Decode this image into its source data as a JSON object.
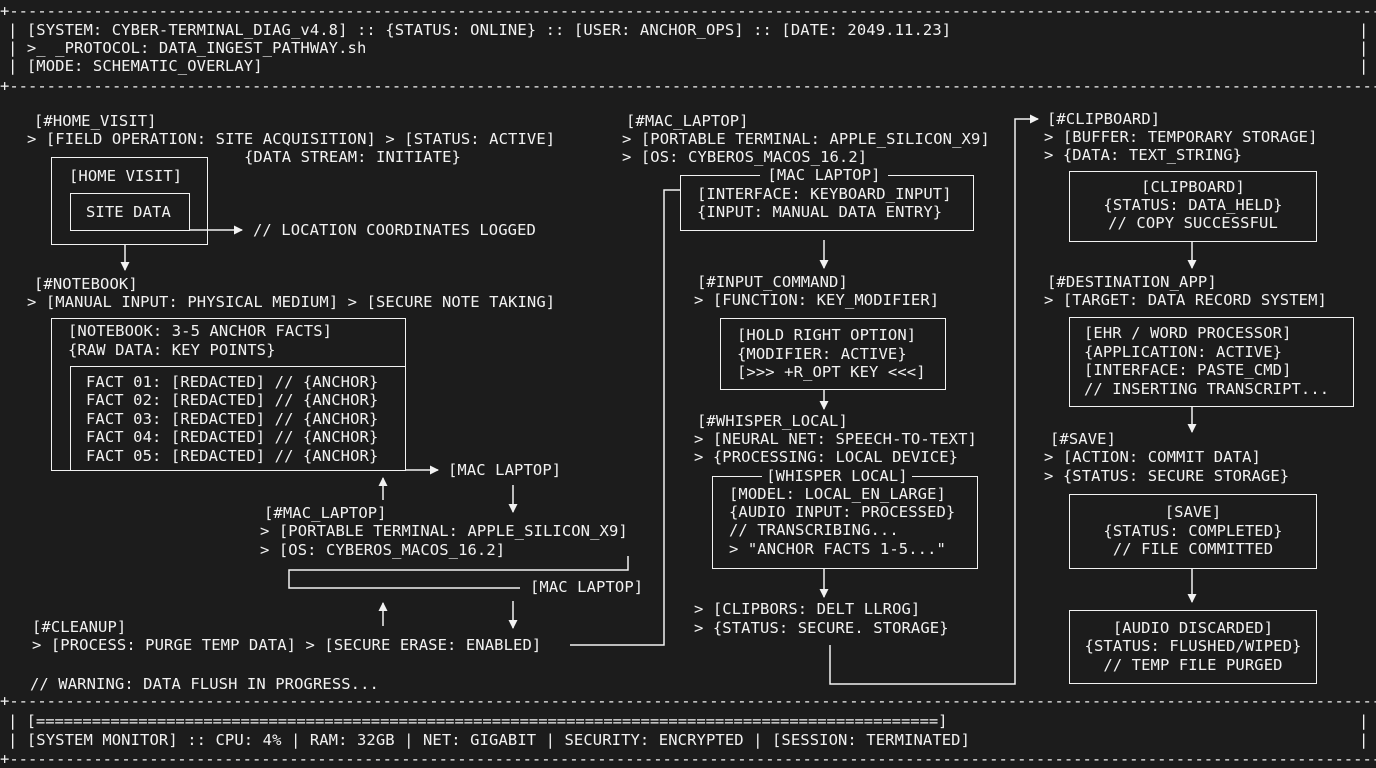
{
  "header": {
    "line1": "| [SYSTEM: CYBER-TERMINAL_DIAG_v4.8] :: {STATUS: ONLINE} :: [USER: ANCHOR_OPS] :: [DATE: 2049.11.23]",
    "line2": "| >_ _PROTOCOL: DATA_INGEST_PATHWAY.sh",
    "line3": "| [MODE: SCHEMATIC_OVERLAY]",
    "right_bar": "|"
  },
  "col1": {
    "home_tag": "[#HOME_VISIT]",
    "home_meta1": "> [FIELD OPERATION: SITE ACQUISITION] > [STATUS: ACTIVE]",
    "home_meta2": "{DATA STREAM: INITIATE}",
    "home_box_title": "[HOME VISIT]",
    "site_data": "SITE DATA",
    "coords_note": "// LOCATION COORDINATES LOGGED",
    "notebook_tag": "[#NOTEBOOK]",
    "notebook_meta": "> [MANUAL INPUT: PHYSICAL MEDIUM] > [SECURE NOTE TAKING]",
    "notebook_box_l1": "[NOTEBOOK: 3-5 ANCHOR FACTS]",
    "notebook_box_l2": "{RAW DATA: KEY POINTS}",
    "facts": [
      "FACT 01: [REDACTED] // {ANCHOR}",
      "FACT 02: [REDACTED] // {ANCHOR}",
      "FACT 03: [REDACTED] // {ANCHOR}",
      "FACT 04: [REDACTED] // {ANCHOR}",
      "FACT 05: [REDACTED] // {ANCHOR}"
    ],
    "mac_label_1": "[MAC LAPTOP]",
    "mac_tag": "[#MAC_LAPTOP]",
    "mac_meta1": "> [PORTABLE TERMINAL: APPLE_SILICON_X9]",
    "mac_meta2": "> [OS: CYBEROS_MACOS_16.2]",
    "mac_label_2": "[MAC LAPTOP]",
    "cleanup_tag": "[#CLEANUP]",
    "cleanup_meta": "> [PROCESS: PURGE TEMP DATA] > [SECURE ERASE: ENABLED]",
    "warning": "// WARNING: DATA FLUSH IN PROGRESS..."
  },
  "col2": {
    "mac_tag": "[#MAC_LAPTOP]",
    "mac_meta1": "> [PORTABLE TERMINAL: APPLE_SILICON_X9]",
    "mac_meta2": "> [OS: CYBEROS_MACOS_16.2]",
    "mac_box_title": "[MAC LAPTOP]",
    "mac_box_l1": "[INTERFACE: KEYBOARD_INPUT]",
    "mac_box_l2": "{INPUT: MANUAL DATA ENTRY}",
    "input_tag": "[#INPUT_COMMAND]",
    "input_meta": "> [FUNCTION: KEY_MODIFIER]",
    "hold_l1": "[HOLD RIGHT OPTION]",
    "hold_l2": "{MODIFIER: ACTIVE}",
    "hold_l3": "[>>> +R_OPT KEY <<<]",
    "whisper_tag": "[#WHISPER_LOCAL]",
    "whisper_meta1": "> [NEURAL NET: SPEECH-TO-TEXT]",
    "whisper_meta2": "> {PROCESSING: LOCAL DEVICE}",
    "whisper_box_title": "[WHISPER LOCAL]",
    "whisper_l1": "[MODEL: LOCAL_EN_LARGE]",
    "whisper_l2": "{AUDIO INPUT: PROCESSED}",
    "whisper_l3": "// TRANSCRIBING...",
    "whisper_l4": "> \"ANCHOR FACTS 1-5...\"",
    "clip_meta1": "> [CLIPBORS: DELT LLROG]",
    "clip_meta2": "> {STATUS: SECURE. STORAGE}"
  },
  "col3": {
    "clip_tag": "[#CLIPBOARD]",
    "clip_meta1": "> [BUFFER: TEMPORARY STORAGE]",
    "clip_meta2": "> {DATA: TEXT_STRING}",
    "clip_box_l1": "[CLIPBOARD]",
    "clip_box_l2": "{STATUS: DATA_HELD}",
    "clip_box_l3": "// COPY SUCCESSFUL",
    "dest_tag": "[#DESTINATION_APP]",
    "dest_meta": "> [TARGET: DATA RECORD SYSTEM]",
    "ehr_l1": "[EHR / WORD PROCESSOR]",
    "ehr_l2": "{APPLICATION: ACTIVE}",
    "ehr_l3": "[INTERFACE: PASTE_CMD]",
    "ehr_l4": "// INSERTING TRANSCRIPT...",
    "save_tag": "[#SAVE]",
    "save_meta1": "> [ACTION: COMMIT DATA]",
    "save_meta2": "> {STATUS: SECURE STORAGE}",
    "save_box_l1": "[SAVE]",
    "save_box_l2": "{STATUS: COMPLETED}",
    "save_box_l3": "// FILE COMMITTED",
    "audio_l1": "[AUDIO DISCARDED]",
    "audio_l2": "{STATUS: FLUSHED/WIPED}",
    "audio_l3": "// TEMP FILE PURGED"
  },
  "footer": {
    "progress": "| [=================================================================================================]",
    "monitor": "| [SYSTEM MONITOR] :: CPU: 4% | RAM: 32GB | NET: GIGABIT | SECURITY: ENCRYPTED | [SESSION: TERMINATED]",
    "right_bar": "|"
  },
  "colors": {
    "background": "#1c1c1c",
    "foreground": "#f2f2f2"
  }
}
